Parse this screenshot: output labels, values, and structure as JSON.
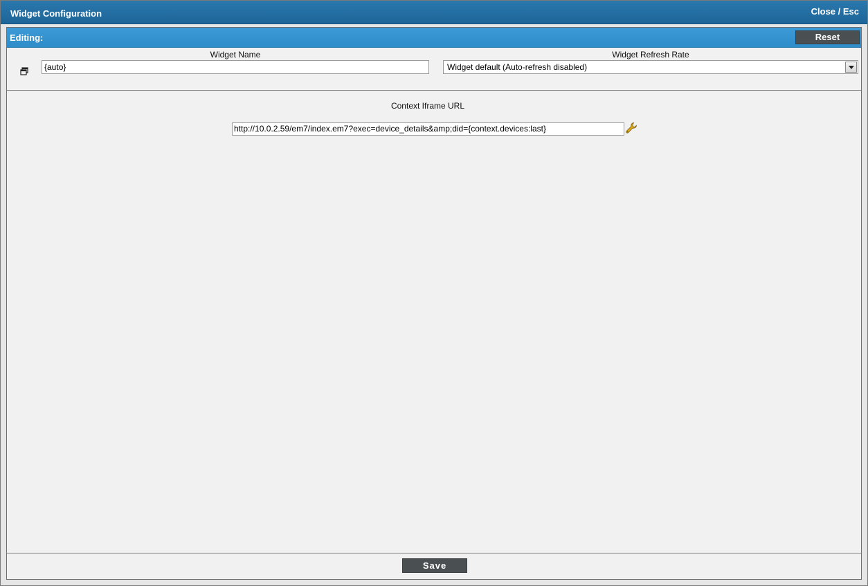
{
  "window": {
    "title": "Widget Configuration",
    "close_label": "Close / Esc"
  },
  "editbar": {
    "label": "Editing:",
    "reset_label": "Reset"
  },
  "form": {
    "widget_name_label": "Widget Name",
    "widget_name_value": "{auto}",
    "refresh_rate_label": "Widget Refresh Rate",
    "refresh_rate_value": "Widget default (Auto-refresh disabled)",
    "context_url_label": "Context Iframe URL",
    "context_url_value": "http://10.0.2.59/em7/index.em7?exec=device_details&amp;did={context.devices:last}"
  },
  "footer": {
    "save_label": "Save"
  },
  "icons": {
    "restore": "restore-window-icon",
    "wrench": "wrench-icon"
  },
  "colors": {
    "titlebar": "#1d6599",
    "editbar": "#3c9bd6",
    "button": "#4a4f52",
    "wrench": "#e0a817"
  }
}
